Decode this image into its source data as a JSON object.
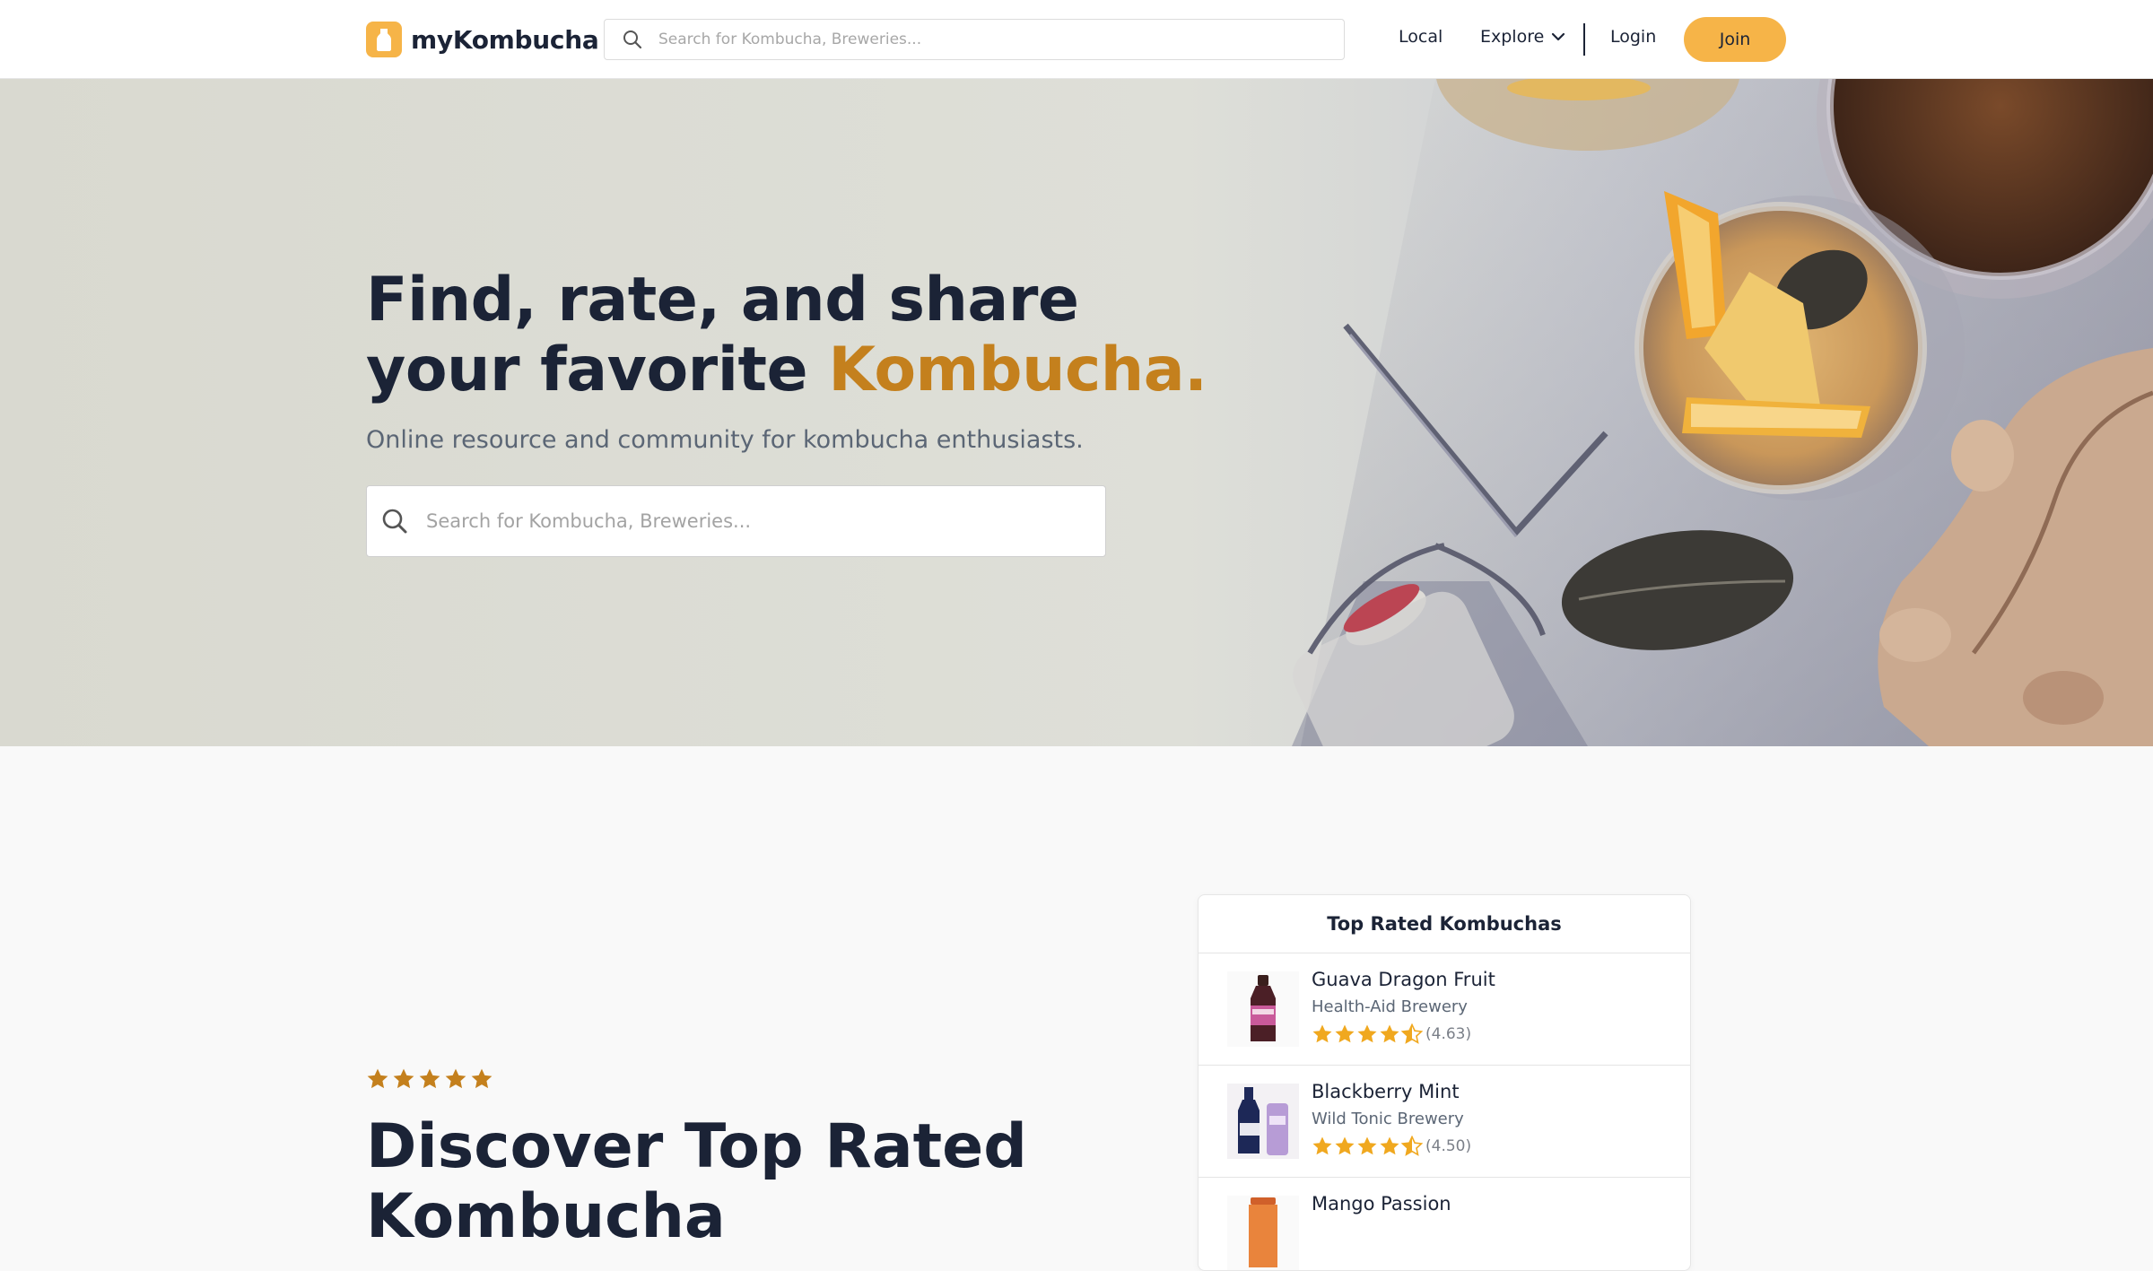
{
  "nav": {
    "brand": "myKombucha",
    "search_placeholder": "Search for Kombucha, Breweries...",
    "links": {
      "local": "Local",
      "explore": "Explore",
      "login": "Login"
    },
    "join_label": "Join"
  },
  "hero": {
    "title_line1": "Find, rate, and share",
    "title_line2_prefix": "your favorite ",
    "title_line2_accent": "Kombucha.",
    "subtitle": "Online resource and community for kombucha enthusiasts.",
    "search_placeholder": "Search for Kombucha, Breweries..."
  },
  "discover": {
    "stars": 5,
    "title_line1": "Discover Top Rated",
    "title_line2": "Kombucha"
  },
  "top_rated": {
    "heading": "Top Rated Kombuchas",
    "items": [
      {
        "name": "Guava Dragon Fruit",
        "brewery": "Health-Aid Brewery",
        "rating": 4.63,
        "rating_text": "(4.63)"
      },
      {
        "name": "Blackberry Mint",
        "brewery": "Wild Tonic Brewery",
        "rating": 4.5,
        "rating_text": "(4.50)"
      },
      {
        "name": "Mango Passion",
        "brewery": "",
        "rating_text": ""
      }
    ]
  },
  "colors": {
    "accent": "#f6b448",
    "accent_text": "#c4801d",
    "text": "#1b2336",
    "muted": "#5b6675",
    "star": "#f0a81f"
  }
}
